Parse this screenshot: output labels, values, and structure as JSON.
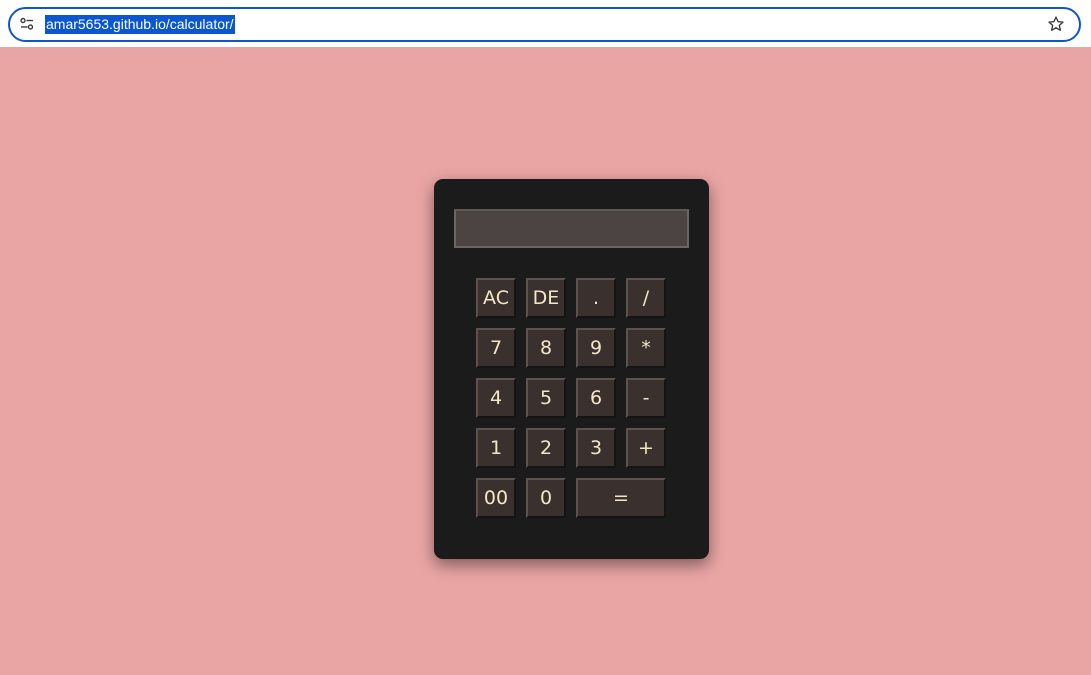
{
  "browser": {
    "url": "amar5653.github.io/calculator/",
    "icons": {
      "site_info": "tune-icon",
      "bookmark": "star-icon"
    },
    "accent": "#0b57d0"
  },
  "page": {
    "background": "#e9a5a4"
  },
  "calculator": {
    "display_value": "",
    "keys": {
      "ac": "AC",
      "de": "DE",
      "dot": ".",
      "divide": "/",
      "seven": "7",
      "eight": "8",
      "nine": "9",
      "multiply": "*",
      "four": "4",
      "five": "5",
      "six": "6",
      "minus": "-",
      "one": "1",
      "two": "2",
      "three": "3",
      "plus": "+",
      "double_zero": "00",
      "zero": "0",
      "equals": "="
    }
  }
}
